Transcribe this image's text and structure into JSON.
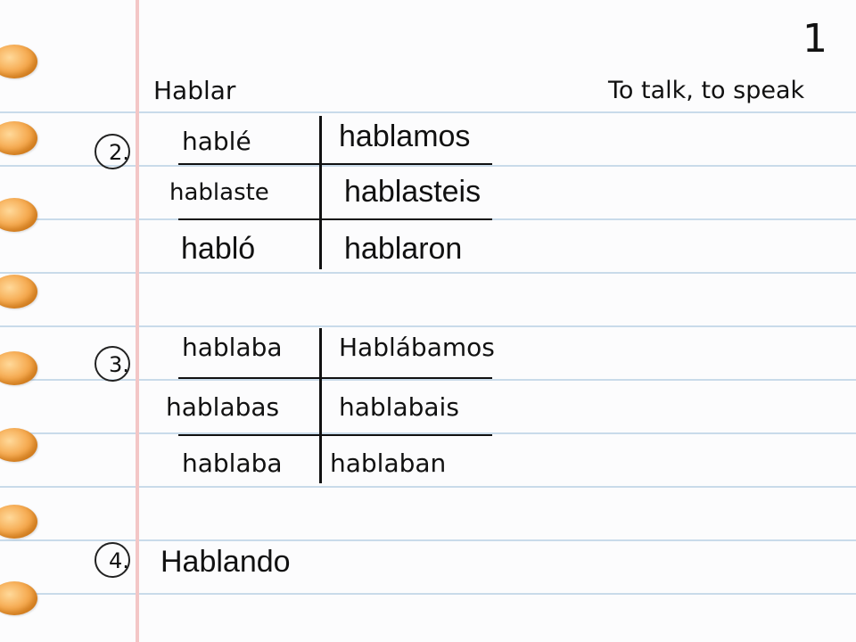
{
  "page": {
    "number": "1"
  },
  "verb": {
    "infinitive": "Hablar",
    "translation": "To talk, to speak"
  },
  "preterite": {
    "number_label": "2.",
    "singular": [
      "hablé",
      "hablaste",
      "habló"
    ],
    "plural": [
      "hablamos",
      "hablasteis",
      "hablaron"
    ]
  },
  "imperfect": {
    "number_label": "3.",
    "singular": [
      "hablaba",
      "hablabas",
      "hablaba"
    ],
    "plural": [
      "Hablábamos",
      "hablabais",
      "hablaban"
    ]
  },
  "gerund": {
    "number_label": "4.",
    "form": "Hablando"
  },
  "colors": {
    "ruled_line": "#c9dbea",
    "margin_line": "#f3c6c6",
    "binder_hole": "#f6ad55",
    "ink": "#111111"
  }
}
